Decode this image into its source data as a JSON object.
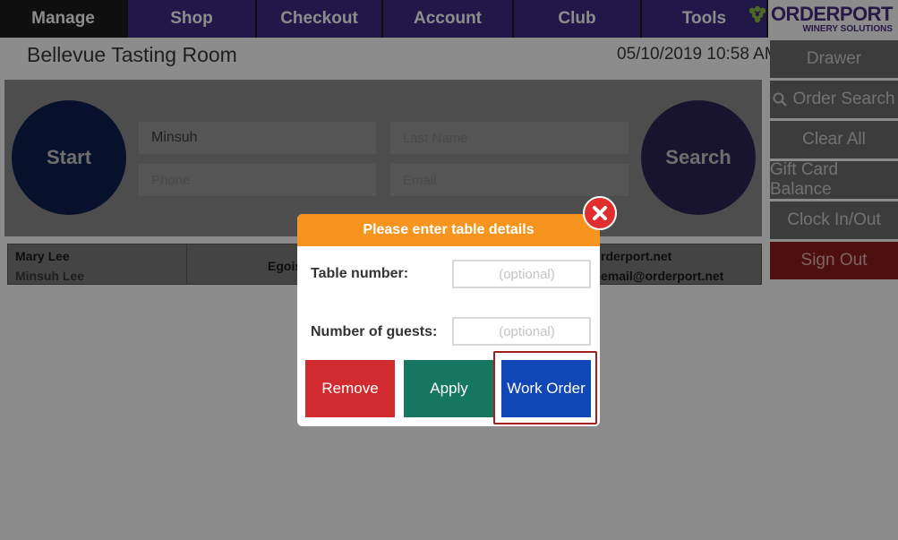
{
  "nav": {
    "tabs": [
      {
        "label": "Manage",
        "active": true
      },
      {
        "label": "Shop",
        "active": false
      },
      {
        "label": "Checkout",
        "active": false
      },
      {
        "label": "Account",
        "active": false
      },
      {
        "label": "Club",
        "active": false
      },
      {
        "label": "Tools",
        "active": false
      }
    ]
  },
  "logo": {
    "name": "ORDERPORT",
    "tagline": "WINERY SOLUTIONS",
    "icon": "grape-icon"
  },
  "header": {
    "location": "Bellevue Tasting Room",
    "datetime": "05/10/2019 10:58 AM"
  },
  "sidebar": {
    "buttons": [
      {
        "label": "Drawer"
      },
      {
        "label": "Order Search",
        "icon": "search-icon"
      },
      {
        "label": "Clear All"
      },
      {
        "label": "Gift Card Balance"
      },
      {
        "label": "Clock In/Out"
      },
      {
        "label": "Sign Out"
      }
    ]
  },
  "search_panel": {
    "start_label": "Start",
    "search_label": "Search",
    "first_name_value": "Minsuh",
    "last_name_placeholder": "Last Name",
    "phone_placeholder": "Phone",
    "email_placeholder": "Email"
  },
  "customer": {
    "name": "Mary Lee",
    "secondary_name": "Minsuh Lee",
    "winery": "Egoist",
    "email_line1": "rderport.net",
    "email_line2": "email@orderport.net"
  },
  "modal": {
    "title": "Please enter table details",
    "table_label": "Table number:",
    "table_placeholder": "(optional)",
    "guests_label": "Number of guests:",
    "guests_placeholder": "(optional)",
    "remove_label": "Remove",
    "apply_label": "Apply",
    "work_order_label": "Work Order"
  },
  "colors": {
    "nav_tab": "#3f2a86",
    "modal_header": "#f5951f",
    "remove": "#d12b2f",
    "apply": "#167760",
    "work_order": "#1046b5",
    "close": "#e02d2d"
  }
}
